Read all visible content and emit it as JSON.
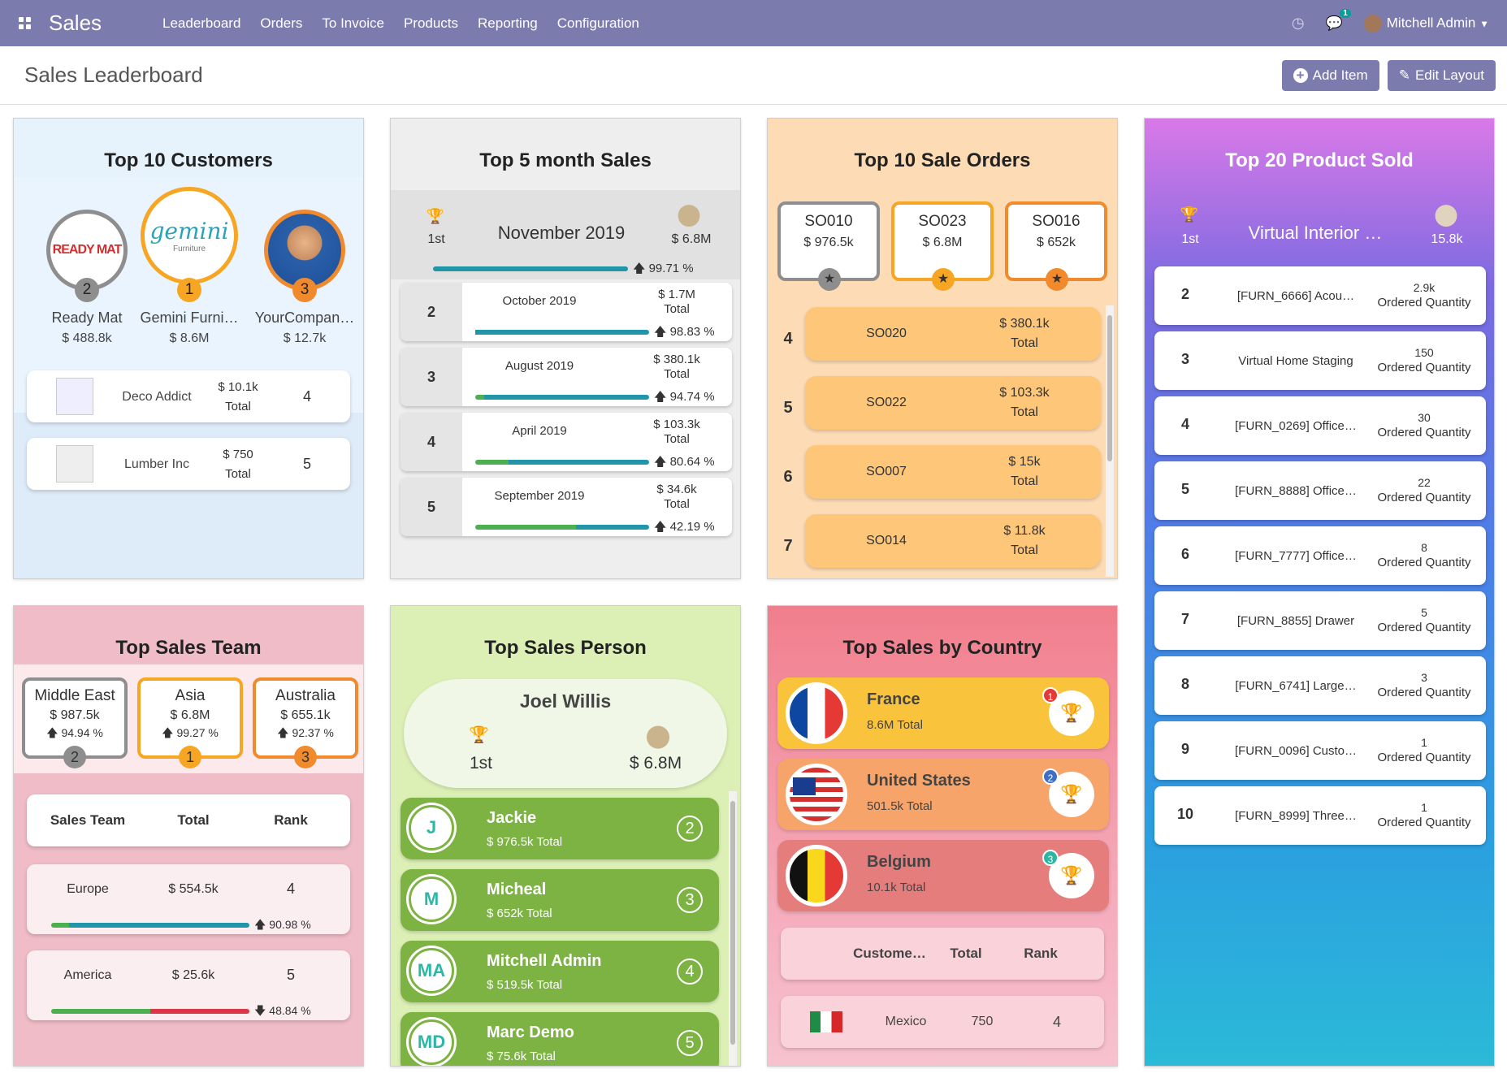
{
  "nav": {
    "app": "Sales",
    "menu": [
      "Leaderboard",
      "Orders",
      "To Invoice",
      "Products",
      "Reporting",
      "Configuration"
    ],
    "chat_count": "1",
    "user": "Mitchell Admin"
  },
  "page": {
    "title": "Sales Leaderboard",
    "add_item": "Add Item",
    "edit_layout": "Edit Layout"
  },
  "customers": {
    "title": "Top 10 Customers",
    "podium": [
      {
        "rank": "2",
        "name": "Ready Mat",
        "value": "$ 488.8k",
        "logo": "READY MAT"
      },
      {
        "rank": "1",
        "name": "Gemini Furni…",
        "value": "$ 8.6M",
        "logo": "gemini",
        "logo_sub": "Furniture"
      },
      {
        "rank": "3",
        "name": "YourCompan…",
        "value": "$ 12.7k"
      }
    ],
    "list": [
      {
        "name": "Deco Addict",
        "value": "$ 10.1k",
        "label": "Total",
        "rank": "4"
      },
      {
        "name": "Lumber Inc",
        "value": "$ 750",
        "label": "Total",
        "rank": "5"
      }
    ]
  },
  "months": {
    "title": "Top 5 month Sales",
    "first": {
      "rank": "1st",
      "name": "November 2019",
      "value": "$ 6.8M",
      "pct": "99.71 %",
      "fill": 0.9971
    },
    "list": [
      {
        "rank": "2",
        "name": "October 2019",
        "value": "$ 1.7M",
        "label": "Total",
        "pct": "98.83 %",
        "fill": 0.9883,
        "green": 0
      },
      {
        "rank": "3",
        "name": "August 2019",
        "value": "$ 380.1k",
        "label": "Total",
        "pct": "94.74 %",
        "fill": 0.9474,
        "green": 0.05
      },
      {
        "rank": "4",
        "name": "April 2019",
        "value": "$ 103.3k",
        "label": "Total",
        "pct": "80.64 %",
        "fill": 0.8064,
        "green": 0.19
      },
      {
        "rank": "5",
        "name": "September 2019",
        "value": "$ 34.6k",
        "label": "Total",
        "pct": "42.19 %",
        "fill": 0.4219,
        "green": 0.58
      }
    ]
  },
  "orders": {
    "title": "Top 10 Sale Orders",
    "podium": [
      {
        "name": "SO010",
        "value": "$ 976.5k"
      },
      {
        "name": "SO023",
        "value": "$ 6.8M"
      },
      {
        "name": "SO016",
        "value": "$ 652k"
      }
    ],
    "list": [
      {
        "rank": "4",
        "name": "SO020",
        "value": "$ 380.1k",
        "label": "Total"
      },
      {
        "rank": "5",
        "name": "SO022",
        "value": "$ 103.3k",
        "label": "Total"
      },
      {
        "rank": "6",
        "name": "SO007",
        "value": "$ 15k",
        "label": "Total"
      },
      {
        "rank": "7",
        "name": "SO014",
        "value": "$ 11.8k",
        "label": "Total"
      }
    ]
  },
  "products": {
    "title": "Top 20 Product Sold",
    "first": {
      "rank": "1st",
      "name": "Virtual Interior …",
      "value": "15.8k"
    },
    "qty_label": "Ordered Quantity",
    "list": [
      {
        "rank": "2",
        "name": "[FURN_6666] Acou…",
        "qty": "2.9k"
      },
      {
        "rank": "3",
        "name": "Virtual Home Staging",
        "qty": "150"
      },
      {
        "rank": "4",
        "name": "[FURN_0269] Office…",
        "qty": "30"
      },
      {
        "rank": "5",
        "name": "[FURN_8888] Office…",
        "qty": "22"
      },
      {
        "rank": "6",
        "name": "[FURN_7777] Office…",
        "qty": "8"
      },
      {
        "rank": "7",
        "name": "[FURN_8855] Drawer",
        "qty": "5"
      },
      {
        "rank": "8",
        "name": "[FURN_6741] Large…",
        "qty": "3"
      },
      {
        "rank": "9",
        "name": "[FURN_0096] Custo…",
        "qty": "1"
      },
      {
        "rank": "10",
        "name": "[FURN_8999] Three…",
        "qty": "1"
      }
    ]
  },
  "teams": {
    "title": "Top Sales Team",
    "podium": [
      {
        "rank": "2",
        "name": "Middle East",
        "value": "$ 987.5k",
        "pct": "94.94 %"
      },
      {
        "rank": "1",
        "name": "Asia",
        "value": "$ 6.8M",
        "pct": "99.27 %"
      },
      {
        "rank": "3",
        "name": "Australia",
        "value": "$ 655.1k",
        "pct": "92.37 %"
      }
    ],
    "headers": [
      "Sales Team",
      "Total",
      "Rank"
    ],
    "list": [
      {
        "name": "Europe",
        "value": "$ 554.5k",
        "rank": "4",
        "pct": "90.98 %",
        "green": 0.09,
        "fill": 0.9098,
        "color": "#2196a8",
        "down": false
      },
      {
        "name": "America",
        "value": "$ 25.6k",
        "rank": "5",
        "pct": "48.84 %",
        "green": 0.5,
        "fill": 1,
        "color": "#dc3545",
        "down": true
      }
    ]
  },
  "person": {
    "title": "Top Sales Person",
    "first": {
      "name": "Joel Willis",
      "rank": "1st",
      "value": "$ 6.8M"
    },
    "list": [
      {
        "initials": "J",
        "name": "Jackie",
        "value": "$ 976.5k Total",
        "rank": "2"
      },
      {
        "initials": "M",
        "name": "Micheal",
        "value": "$ 652k Total",
        "rank": "3"
      },
      {
        "initials": "MA",
        "name": "Mitchell Admin",
        "value": "$ 519.5k Total",
        "rank": "4"
      },
      {
        "initials": "MD",
        "name": "Marc Demo",
        "value": "$ 75.6k Total",
        "rank": "5"
      }
    ]
  },
  "country": {
    "title": "Top Sales by Country",
    "podium": [
      {
        "name": "France",
        "value": "8.6M Total",
        "rank": "1",
        "bg": "#f9c33c",
        "badge": "#e53935"
      },
      {
        "name": "United States",
        "value": "501.5k Total",
        "rank": "2",
        "bg": "#f6a46a",
        "badge": "#3f6fc4"
      },
      {
        "name": "Belgium",
        "value": "10.1k Total",
        "rank": "3",
        "bg": "#e57d7d",
        "badge": "#2cb5a0"
      }
    ],
    "headers": [
      "Custome…",
      "Total",
      "Rank"
    ],
    "list": [
      {
        "name": "Mexico",
        "value": "750",
        "rank": "4"
      }
    ]
  },
  "colors": {
    "nav": "#7c7bad",
    "gold": "#f6a623",
    "silver": "#8e8e8e",
    "bronze": "#f08a2c",
    "teal": "#2196a8",
    "green": "#4caf50"
  }
}
